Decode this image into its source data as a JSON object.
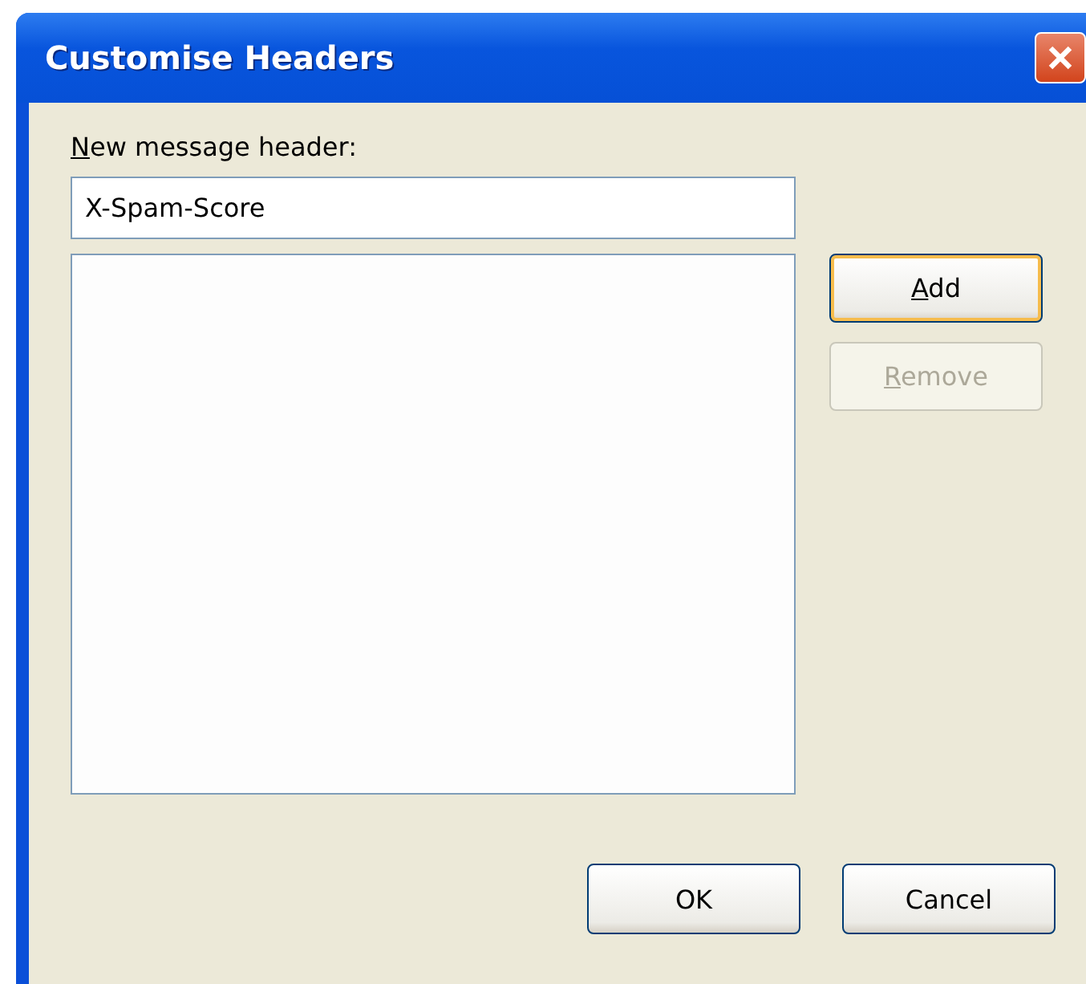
{
  "window": {
    "title": "Customise Headers"
  },
  "header_field": {
    "label": {
      "access_key": "N",
      "rest": "ew message header:"
    },
    "value": "X-Spam-Score"
  },
  "side_buttons": [
    {
      "access_key": "A",
      "rest": "dd",
      "default": true,
      "disabled": false
    },
    {
      "access_key": "R",
      "rest": "emove",
      "default": false,
      "disabled": true
    }
  ],
  "buttons": [
    {
      "label": "OK",
      "default": false,
      "disabled": false
    },
    {
      "label": "Cancel",
      "default": false,
      "disabled": false
    }
  ]
}
